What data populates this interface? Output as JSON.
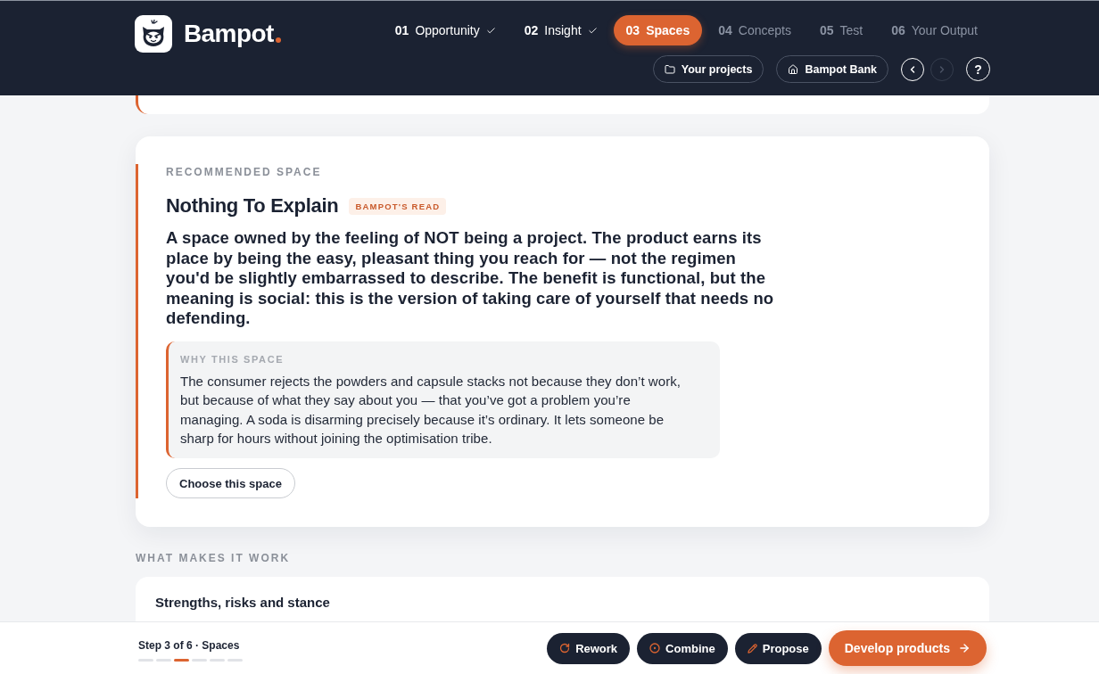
{
  "header": {
    "brand": "Bampot",
    "steps": [
      {
        "number": "01",
        "label": "Opportunity",
        "completed": true,
        "selected": false
      },
      {
        "number": "02",
        "label": "Insight",
        "completed": true,
        "selected": false
      },
      {
        "number": "03",
        "label": "Spaces",
        "completed": false,
        "selected": true
      },
      {
        "number": "04",
        "label": "Concepts",
        "completed": false,
        "selected": false
      },
      {
        "number": "05",
        "label": "Test",
        "completed": false,
        "selected": false
      },
      {
        "number": "06",
        "label": "Your Output",
        "completed": false,
        "selected": false
      }
    ],
    "actions": [
      {
        "label": "Your projects",
        "kind": "projects"
      },
      {
        "label": "Bampot Bank",
        "kind": "bank"
      }
    ],
    "pager": {
      "previous": {
        "disabled": false
      },
      "next": {
        "disabled": true
      }
    },
    "help": "?"
  },
  "recommended": {
    "eyebrow": "RECOMMENDED SPACE",
    "title": "Nothing To Explain",
    "badge": "BAMPOT'S READ",
    "summary": "A space owned by the feeling of NOT being a project. The product earns its place by being the easy, pleasant thing you reach for — not the regimen you'd be slightly embarrassed to describe. The benefit is functional, but the meaning is social: this is the version of taking care of yourself that needs no defending.",
    "why": {
      "label": "WHY THIS SPACE",
      "text": "The consumer rejects the powders and capsule stacks not because they don’t work, but because of what they say about you — that you’ve got a problem you’re managing. A soda is disarming precisely because it’s ordinary. It lets someone be sharp for hours without joining the optimisation tribe."
    },
    "button": "Choose this space"
  },
  "section": {
    "label": "WHAT MAKES IT WORK",
    "card_title": "Strengths, risks and stance"
  },
  "footer": {
    "step": "Step 3 of 6 · Spaces",
    "progress": [
      {
        "selected": false
      },
      {
        "selected": false
      },
      {
        "selected": true
      },
      {
        "selected": false
      },
      {
        "selected": false
      },
      {
        "selected": false
      }
    ],
    "buttons": [
      {
        "label": "Rework",
        "kind": "rework"
      },
      {
        "label": "Combine",
        "kind": "combine"
      },
      {
        "label": "Propose",
        "kind": "propose"
      },
      {
        "label": "Develop products",
        "kind": "primary"
      }
    ]
  }
}
